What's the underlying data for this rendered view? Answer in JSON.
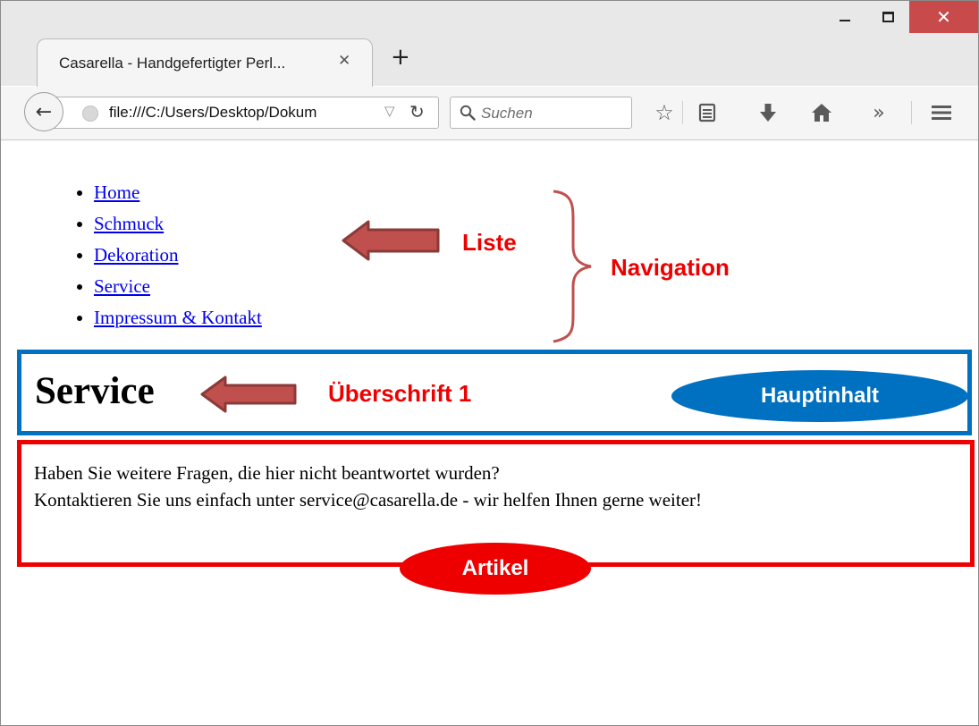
{
  "browser": {
    "window_controls": {
      "minimize": "_",
      "maximize": "□",
      "close": "✕"
    },
    "tab": {
      "title": "Casarella - Handgefertigter Perl...",
      "close": "✕",
      "new_tab": "+"
    },
    "url": "file:///C:/Users/Desktop/Dokum",
    "search_placeholder": "Suchen",
    "toolbar_icons": [
      "back-arrow-icon",
      "globe-icon",
      "dropmarker-icon",
      "reload-icon",
      "search-icon",
      "bookmark-star-icon",
      "reading-list-icon",
      "download-icon",
      "home-icon",
      "overflow-chevron-icon",
      "hamburger-menu-icon"
    ]
  },
  "page": {
    "nav_items": [
      "Home",
      "Schmuck",
      "Dekoration",
      "Service",
      "Impressum & Kontakt"
    ],
    "heading": "Service",
    "article_lines": [
      "Haben Sie weitere Fragen, die hier nicht beantwortet wurden?",
      "Kontaktieren Sie uns einfach unter service@casarella.de - wir helfen Ihnen gerne weiter!"
    ]
  },
  "annotations": {
    "list_label": "Liste",
    "navigation_label": "Navigation",
    "heading_label": "Überschrift 1",
    "main_label": "Hauptinhalt",
    "article_label": "Artikel"
  },
  "colors": {
    "link": "#0000ee",
    "main_border": "#0070c0",
    "article_border": "#ee0000",
    "annotation_text": "#ee0000",
    "arrow_fill": "#c0504d",
    "arrow_stroke": "#8b3a38",
    "close_button": "#c94a4a"
  }
}
